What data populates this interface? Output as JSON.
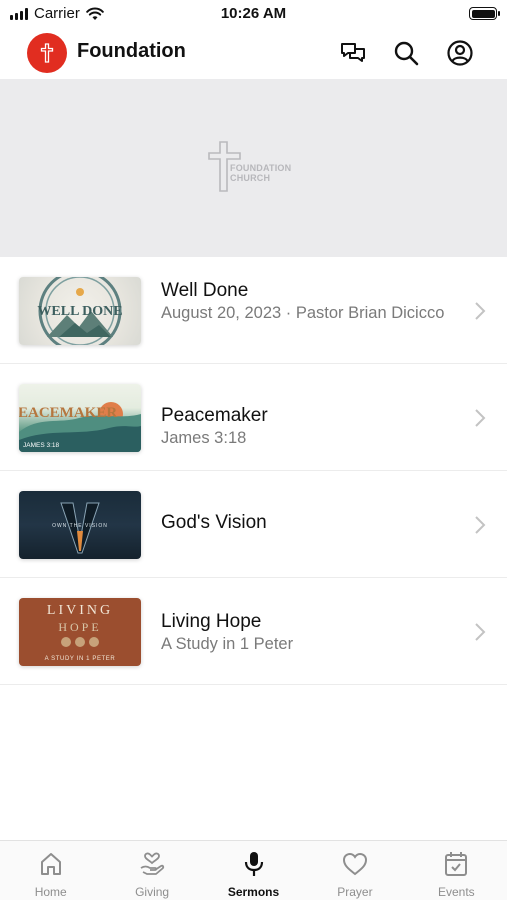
{
  "status_bar": {
    "carrier": "Carrier",
    "time": "10:26 AM"
  },
  "header": {
    "title": "Foundation"
  },
  "banner": {
    "logo_line1": "FOUNDATION",
    "logo_line2": "CHURCH"
  },
  "sermons": [
    {
      "title": "Well Done",
      "subtitle": "August 20, 2023 · Pastor Brian Dicicco",
      "thumb_text": "WELL DONE"
    },
    {
      "title": "Peacemaker",
      "subtitle": "James 3:18",
      "thumb_text": "PEACEMAKER",
      "thumb_sub": "JAMES 3:18"
    },
    {
      "title": "God's Vision",
      "subtitle": "",
      "thumb_text": "OWN THE VISION"
    },
    {
      "title": "Living Hope",
      "subtitle": "A Study in 1 Peter",
      "thumb_line1": "LIVING",
      "thumb_line2": "HOPE",
      "thumb_sub": "A STUDY IN 1 PETER"
    }
  ],
  "tabs": [
    {
      "label": "Home",
      "icon": "home-icon"
    },
    {
      "label": "Giving",
      "icon": "giving-icon"
    },
    {
      "label": "Sermons",
      "icon": "microphone-icon",
      "active": true
    },
    {
      "label": "Prayer",
      "icon": "heart-icon"
    },
    {
      "label": "Events",
      "icon": "calendar-icon"
    }
  ],
  "colors": {
    "brand": "#e12d20",
    "banner_bg": "#ebebed",
    "inactive_tab": "#8e8e8e"
  }
}
